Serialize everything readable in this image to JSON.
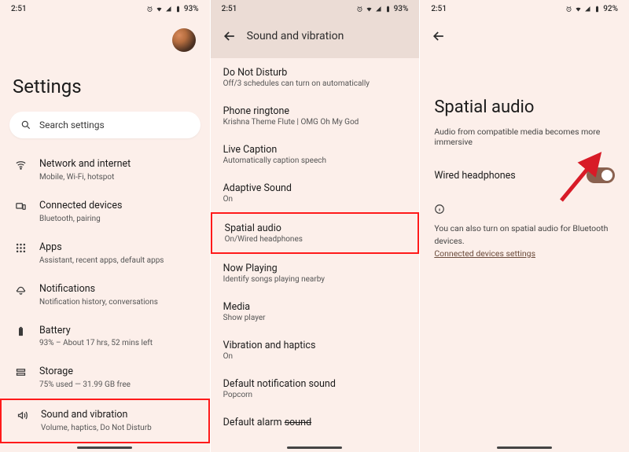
{
  "statusbar": {
    "time": "2:51",
    "battery_p1": "93%",
    "battery_p2": "93%",
    "battery_p3": "92%"
  },
  "panel1": {
    "title": "Settings",
    "search_placeholder": "Search settings",
    "items": [
      {
        "title": "Network and internet",
        "sub": "Mobile, Wi-Fi, hotspot"
      },
      {
        "title": "Connected devices",
        "sub": "Bluetooth, pairing"
      },
      {
        "title": "Apps",
        "sub": "Assistant, recent apps, default apps"
      },
      {
        "title": "Notifications",
        "sub": "Notification history, conversations"
      },
      {
        "title": "Battery",
        "sub": "93% – About 17 hrs, 52 mins left"
      },
      {
        "title": "Storage",
        "sub": "75% used — 31.99 GB free"
      },
      {
        "title": "Sound and vibration",
        "sub": "Volume, haptics, Do Not Disturb"
      }
    ]
  },
  "panel2": {
    "header": "Sound and vibration",
    "items": [
      {
        "title": "Do Not Disturb",
        "sub": "Off/3 schedules can turn on automatically"
      },
      {
        "title": "Phone ringtone",
        "sub": "Krishna Theme Flute | OMG Oh My God"
      },
      {
        "title": "Live Caption",
        "sub": "Automatically caption speech"
      },
      {
        "title": "Adaptive Sound",
        "sub": "On"
      },
      {
        "title": "Spatial audio",
        "sub": "On/Wired headphones"
      },
      {
        "title": "Now Playing",
        "sub": "Identify songs playing nearby"
      },
      {
        "title": "Media",
        "sub": "Show player"
      },
      {
        "title": "Vibration and haptics",
        "sub": "On"
      },
      {
        "title": "Default notification sound",
        "sub": "Popcorn"
      },
      {
        "title": "Default alarm ",
        "sub": ""
      }
    ],
    "last_strike": "sound"
  },
  "panel3": {
    "title": "Spatial audio",
    "desc": "Audio from compatible media becomes more immersive",
    "toggle_label": "Wired headphones",
    "toggle_on": true,
    "info_text_prefix": "You can also turn on spatial audio for ",
    "info_text_bt": "Bluetooth",
    "info_text_suffix": " devices.",
    "link": "Connected devices settings"
  }
}
